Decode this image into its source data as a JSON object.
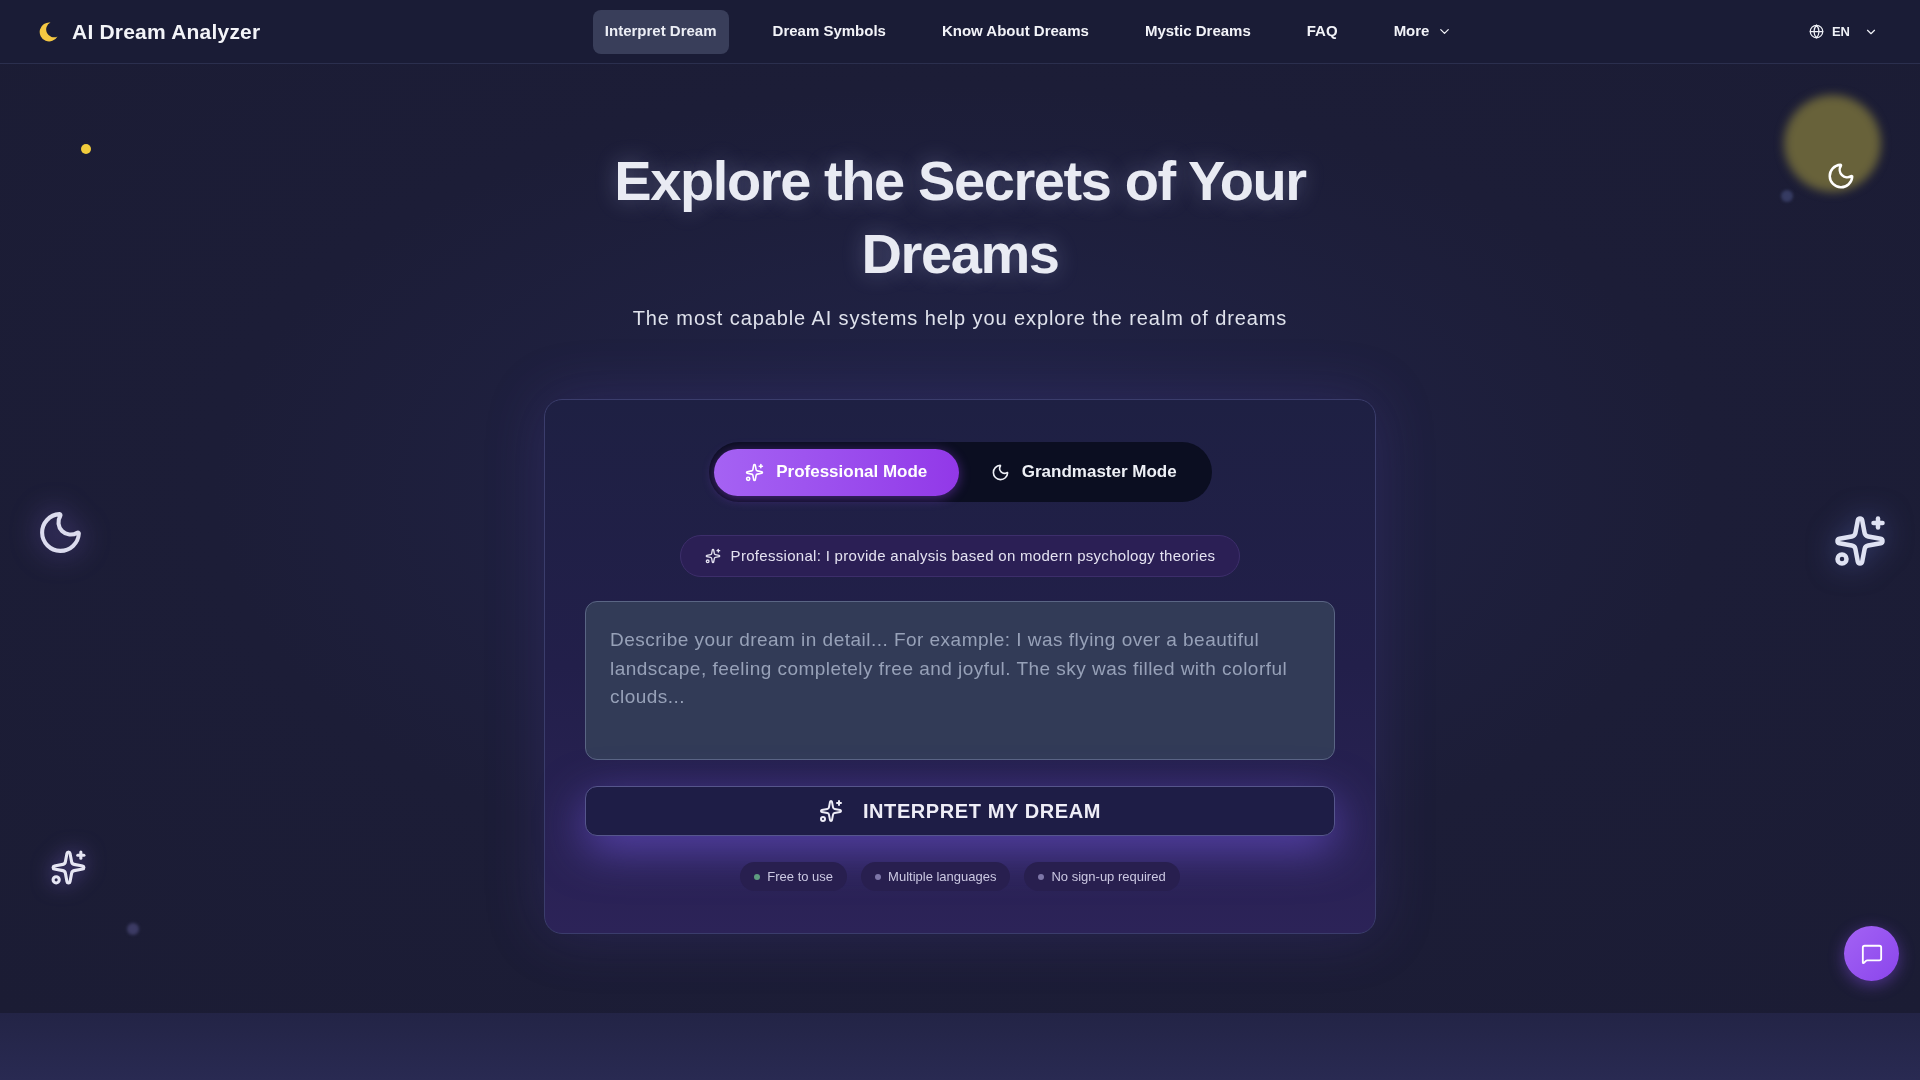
{
  "header": {
    "brand": "AI Dream Analyzer",
    "nav": [
      {
        "label": "Interpret Dream",
        "kind": "link",
        "selected": true
      },
      {
        "label": "Dream Symbols",
        "kind": "link",
        "selected": false
      },
      {
        "label": "Know About Dreams",
        "kind": "link",
        "selected": false
      },
      {
        "label": "Mystic Dreams",
        "kind": "link",
        "selected": false
      },
      {
        "label": "FAQ",
        "kind": "link",
        "selected": false
      },
      {
        "label": "More",
        "kind": "dropdown",
        "selected": false
      }
    ],
    "language": "EN"
  },
  "hero": {
    "title": "Explore the Secrets of Your Dreams",
    "subtitle": "The most capable AI systems help you explore the realm of dreams"
  },
  "analyzer": {
    "modes": [
      {
        "label": "Professional Mode",
        "selected": true
      },
      {
        "label": "Grandmaster Mode",
        "selected": false
      }
    ],
    "mode_hint": "Professional: I provide analysis based on modern psychology theories",
    "dream_input": {
      "placeholder": "Describe your dream in detail... For example: I was flying over a beautiful landscape, feeling completely free and joyful. The sky was filled with colorful clouds..."
    },
    "submit_button": "INTERPRET MY DREAM",
    "features": [
      {
        "label": "Free to use",
        "color": "#5e9c80"
      },
      {
        "label": "Multiple languages",
        "color": "#7d76a8"
      },
      {
        "label": "No sign-up required",
        "color": "#7d76a8"
      }
    ]
  }
}
